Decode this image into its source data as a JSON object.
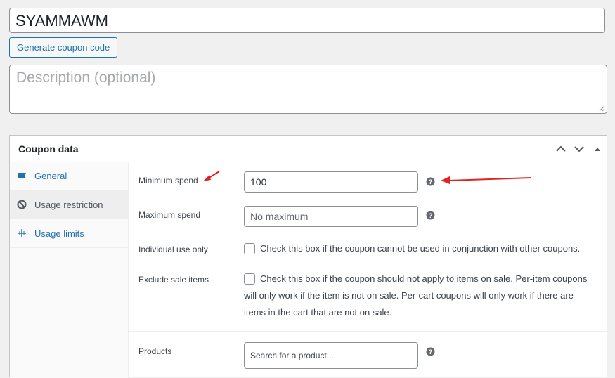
{
  "coupon": {
    "code": "SYAMMAWM",
    "generate_label": "Generate coupon code",
    "description_placeholder": "Description (optional)"
  },
  "panel": {
    "title": "Coupon data",
    "tabs": [
      {
        "label": "General",
        "icon": "ticket-icon"
      },
      {
        "label": "Usage restriction",
        "icon": "ban-icon"
      },
      {
        "label": "Usage limits",
        "icon": "limits-icon"
      }
    ],
    "fields": {
      "minimum_spend": {
        "label": "Minimum spend",
        "value": "100"
      },
      "maximum_spend": {
        "label": "Maximum spend",
        "placeholder": "No maximum"
      },
      "individual_use": {
        "label": "Individual use only",
        "text": "Check this box if the coupon cannot be used in conjunction with other coupons."
      },
      "exclude_sale": {
        "label": "Exclude sale items",
        "line1": "Check this box if the coupon should not apply to items on sale. Per-item coupons",
        "line2": "will only work if the item is not on sale. Per-cart coupons will only work if there are",
        "line3": "items in the cart that are not on sale."
      },
      "products": {
        "label": "Products",
        "placeholder": "Search for a product..."
      }
    }
  },
  "colors": {
    "accent": "#2271b1",
    "annotation": "#e02424"
  }
}
